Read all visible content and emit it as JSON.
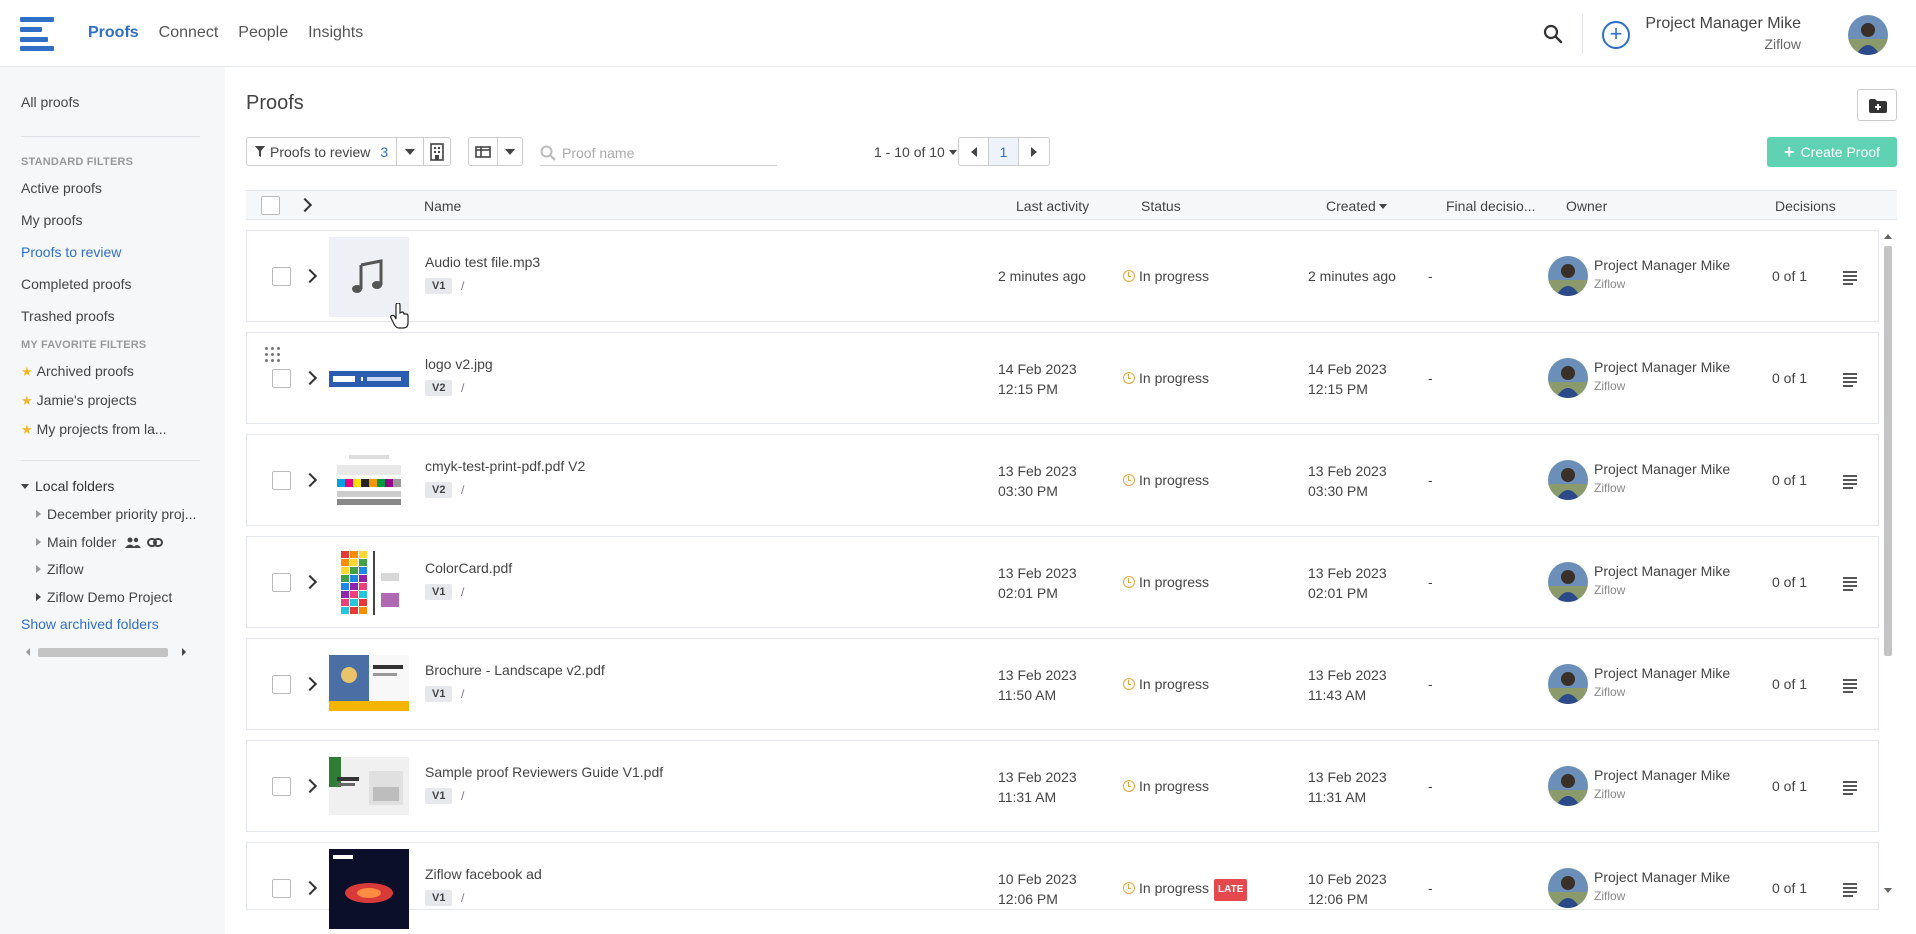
{
  "topnav": {
    "items": [
      {
        "label": "Proofs",
        "active": true
      },
      {
        "label": "Connect",
        "active": false
      },
      {
        "label": "People",
        "active": false
      },
      {
        "label": "Insights",
        "active": false
      }
    ],
    "user_name": "Project Manager Mike",
    "user_org": "Ziflow"
  },
  "sidebar": {
    "all_proofs": "All proofs",
    "standard_filters_header": "STANDARD FILTERS",
    "standard_filters": [
      "Active proofs",
      "My proofs",
      "Proofs to review",
      "Completed proofs",
      "Trashed proofs"
    ],
    "active_filter": "Proofs to review",
    "favorite_filters_header": "MY FAVORITE FILTERS",
    "favorite_filters": [
      "Archived proofs",
      "Jamie's projects",
      "My projects from la..."
    ],
    "local_folders_label": "Local folders",
    "folders": [
      "December priority proj...",
      "Main folder",
      "Ziflow",
      "Ziflow Demo Project"
    ],
    "show_archived": "Show archived folders"
  },
  "main": {
    "title": "Proofs",
    "filter_label": "Proofs to review",
    "filter_count": "3",
    "search_placeholder": "Proof name",
    "pager_text": "1 - 10 of 10",
    "current_page": "1",
    "create_label": "Create Proof"
  },
  "table": {
    "headers": {
      "name": "Name",
      "last_activity": "Last activity",
      "status": "Status",
      "created": "Created",
      "final_decision": "Final decisio...",
      "owner": "Owner",
      "decisions": "Decisions"
    },
    "rows": [
      {
        "name": "Audio test file.mp3",
        "version": "V1",
        "last_activity_1": "2 minutes ago",
        "last_activity_2": "",
        "status": "In progress",
        "late": "",
        "created_1": "2 minutes ago",
        "created_2": "",
        "final_decision": "-",
        "owner": "Project Manager Mike",
        "owner_org": "Ziflow",
        "decisions": "0 of 1",
        "thumb": "audio"
      },
      {
        "name": "logo v2.jpg",
        "version": "V2",
        "last_activity_1": "14 Feb 2023",
        "last_activity_2": "12:15 PM",
        "status": "In progress",
        "late": "",
        "created_1": "14 Feb 2023",
        "created_2": "12:15 PM",
        "final_decision": "-",
        "owner": "Project Manager Mike",
        "owner_org": "Ziflow",
        "decisions": "0 of 1",
        "thumb": "logo"
      },
      {
        "name": "cmyk-test-print-pdf.pdf V2",
        "version": "V2",
        "last_activity_1": "13 Feb 2023",
        "last_activity_2": "03:30 PM",
        "status": "In progress",
        "late": "",
        "created_1": "13 Feb 2023",
        "created_2": "03:30 PM",
        "final_decision": "-",
        "owner": "Project Manager Mike",
        "owner_org": "Ziflow",
        "decisions": "0 of 1",
        "thumb": "cmyk"
      },
      {
        "name": "ColorCard.pdf",
        "version": "V1",
        "last_activity_1": "13 Feb 2023",
        "last_activity_2": "02:01 PM",
        "status": "In progress",
        "late": "",
        "created_1": "13 Feb 2023",
        "created_2": "02:01 PM",
        "final_decision": "-",
        "owner": "Project Manager Mike",
        "owner_org": "Ziflow",
        "decisions": "0 of 1",
        "thumb": "colorcard"
      },
      {
        "name": "Brochure - Landscape v2.pdf",
        "version": "V1",
        "last_activity_1": "13 Feb 2023",
        "last_activity_2": "11:50 AM",
        "status": "In progress",
        "late": "",
        "created_1": "13 Feb 2023",
        "created_2": "11:43 AM",
        "final_decision": "-",
        "owner": "Project Manager Mike",
        "owner_org": "Ziflow",
        "decisions": "0 of 1",
        "thumb": "brochure"
      },
      {
        "name": "Sample proof Reviewers Guide V1.pdf",
        "version": "V1",
        "last_activity_1": "13 Feb 2023",
        "last_activity_2": "11:31 AM",
        "status": "In progress",
        "late": "",
        "created_1": "13 Feb 2023",
        "created_2": "11:31 AM",
        "final_decision": "-",
        "owner": "Project Manager Mike",
        "owner_org": "Ziflow",
        "decisions": "0 of 1",
        "thumb": "guide"
      },
      {
        "name": "Ziflow facebook ad",
        "version": "V1",
        "last_activity_1": "10 Feb 2023",
        "last_activity_2": "12:06 PM",
        "status": "In progress",
        "late": "LATE",
        "created_1": "10 Feb 2023",
        "created_2": "12:06 PM",
        "final_decision": "-",
        "owner": "Project Manager Mike",
        "owner_org": "Ziflow",
        "decisions": "0 of 1",
        "thumb": "fb"
      }
    ]
  },
  "colors": {
    "accent": "#2f6fc6",
    "create_button": "#5fd2b3",
    "status_in_progress": "#e8a53a",
    "late_badge": "#e5484d",
    "star": "#f2b72a"
  },
  "icons": [
    "menu-icon",
    "search-icon",
    "plus-icon",
    "folder-add-icon",
    "filter-icon",
    "building-icon",
    "columns-icon",
    "chevron-right-icon",
    "music-note-icon",
    "drag-handle-icon",
    "star-icon",
    "people-icon",
    "link-icon"
  ]
}
